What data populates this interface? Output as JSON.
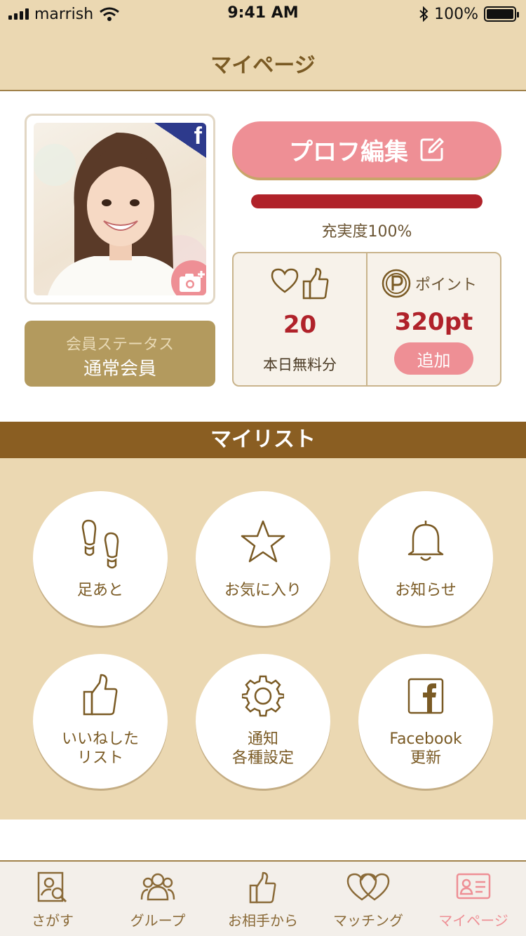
{
  "status_bar": {
    "carrier": "marrish",
    "time": "9:41 AM",
    "battery": "100%"
  },
  "nav": {
    "title": "マイページ"
  },
  "profile": {
    "facebook_badge": "f",
    "member_status_label": "会員ステータス",
    "member_status_value": "通常会員",
    "edit_label": "プロフ編集",
    "completion": 1.0,
    "completion_text": "充実度100%",
    "free_likes_count": "20",
    "free_likes_label": "本日無料分",
    "points_label": "ポイント",
    "points_value": "320pt",
    "add_points_label": "追加"
  },
  "mylist": {
    "title": "マイリスト",
    "items": [
      {
        "label": "足あと",
        "icon": "footprints-icon"
      },
      {
        "label": "お気に入り",
        "icon": "star-icon"
      },
      {
        "label": "お知らせ",
        "icon": "bell-icon"
      },
      {
        "label": "いいねした\nリスト",
        "icon": "thumbs-up-icon"
      },
      {
        "label": "通知\n各種設定",
        "icon": "gear-icon"
      },
      {
        "label": "Facebook\n更新",
        "icon": "facebook-icon"
      }
    ]
  },
  "tab_bar": {
    "items": [
      {
        "label": "さがす",
        "icon": "search-profile-icon"
      },
      {
        "label": "グループ",
        "icon": "group-icon"
      },
      {
        "label": "お相手から",
        "icon": "thumbs-up-icon"
      },
      {
        "label": "マッチング",
        "icon": "hearts-icon"
      },
      {
        "label": "マイページ",
        "icon": "profile-card-icon"
      }
    ],
    "active_index": 4
  },
  "colors": {
    "header_bg": "#ebd8b2",
    "brown": "#8a5e22",
    "pink": "#ee8f95",
    "red": "#b0222a",
    "gold": "#b39a5e"
  }
}
